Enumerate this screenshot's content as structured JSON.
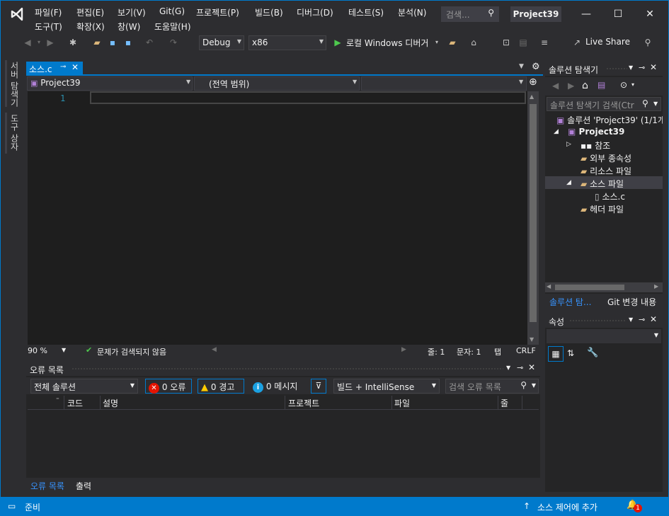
{
  "menu": {
    "row1": [
      "파일(F)",
      "편집(E)",
      "보기(V)",
      "Git(G)",
      "프로젝트(P)",
      "빌드(B)",
      "디버그(D)",
      "테스트(S)",
      "분석(N)"
    ],
    "row2": [
      "도구(T)",
      "확장(X)",
      "창(W)",
      "도움말(H)"
    ]
  },
  "search": {
    "placeholder": "검색..."
  },
  "window": {
    "title": "Project39"
  },
  "toolbar": {
    "config": "Debug",
    "platform": "x86",
    "run_label": "로컬 Windows 디버거",
    "live_share": "Live Share"
  },
  "left_tabs": [
    "서버 탐색기",
    "도구 상자"
  ],
  "editor": {
    "tab_label": "소스.c",
    "nav_project": "Project39",
    "nav_scope": "(전역 범위)",
    "line_number": "1",
    "zoom": "90 %",
    "issues": "문제가 검색되지 않음",
    "line": "줄: 1",
    "char": "문자: 1",
    "tab": "탭",
    "eol": "CRLF"
  },
  "error_list": {
    "title": "오류 목록",
    "scope": "전체 솔루션",
    "errors": "0 오류",
    "warnings": "0 경고",
    "messages": "0 메시지",
    "filter": "빌드 + IntelliSense",
    "search_placeholder": "검색 오류 목록",
    "columns": [
      "코드",
      "설명",
      "프로젝트",
      "파일",
      "줄"
    ],
    "tabs": [
      "오류 목록",
      "출력"
    ]
  },
  "solution_explorer": {
    "title": "솔루션 탐색기",
    "search_placeholder": "솔루션 탐색기 검색(Ctr",
    "tree": [
      {
        "label": "솔루션 'Project39' (1/1개",
        "level": 0,
        "icon": "solution-icon"
      },
      {
        "label": "Project39",
        "level": 1,
        "icon": "project-icon"
      },
      {
        "label": "참조",
        "level": 2,
        "icon": "references-icon"
      },
      {
        "label": "외부 종속성",
        "level": 2,
        "icon": "folder-icon"
      },
      {
        "label": "리소스 파일",
        "level": 2,
        "icon": "folder-icon"
      },
      {
        "label": "소스 파일",
        "level": 2,
        "icon": "folder-icon"
      },
      {
        "label": "소스.c",
        "level": 3,
        "icon": "file-icon"
      },
      {
        "label": "헤더 파일",
        "level": 2,
        "icon": "folder-icon"
      }
    ],
    "tabs": [
      "솔루션 탐...",
      "Git 변경 내용"
    ]
  },
  "properties": {
    "title": "속성"
  },
  "statusbar": {
    "ready": "준비",
    "source_control": "소스 제어에 추가",
    "notification_count": "1"
  },
  "colors": {
    "accent": "#007acc",
    "background": "#2d2d30",
    "editor": "#1e1e1e"
  }
}
